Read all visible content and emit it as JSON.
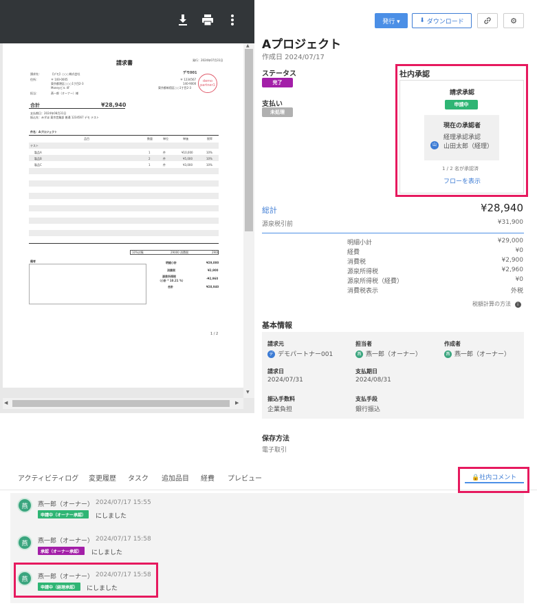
{
  "viewer": {
    "icons": [
      "download-icon",
      "print-icon",
      "more-vert-icon"
    ],
    "doc": {
      "title": "請求書",
      "date": "発行：2024年07月31日",
      "to_label": "請求先：",
      "to_name": "【デモ】○○○株式会社",
      "addr_label": "住所：",
      "addr1": "〒 100-0005",
      "addr2": "東京都港区○○○1丁目2-3",
      "addr3": "Moneyビル 4F",
      "person_label": "担当：",
      "person": "燕一郎（オーナー）様",
      "from_name": "デモ001",
      "from_zip": "〒 1234567",
      "from_tel": "140-9000",
      "from_addr": "東京都新宿区○○1丁目2-3",
      "stamp": "demo partner1",
      "total_label": "合計",
      "total": "¥28,940",
      "due": "支払期日：2024年08月31日",
      "bank": "振込先：みずほ 東京営業部 普通 1234567 デモ テスト",
      "subject": "件名：Aプロジェクト",
      "col_item": "品目",
      "col_qty": "数量",
      "col_unit": "単位",
      "col_price": "単価",
      "col_tax": "税率",
      "group": "テスト",
      "rows": [
        {
          "item": "製品A",
          "qty": "1",
          "unit": "件",
          "price": "¥10,000",
          "tax": "10%"
        },
        {
          "item": "製品B",
          "qty": "2",
          "unit": "件",
          "price": "¥5,000",
          "tax": "10%"
        },
        {
          "item": "製品C",
          "qty": "1",
          "unit": "件",
          "price": "¥3,000",
          "tax": "10%"
        }
      ],
      "tax_box1": "10%対象",
      "tax_box2": "29000",
      "tax_box3": "消費税",
      "tax_box4": "2900",
      "memo": "備考",
      "s1l": "明細小計",
      "s1v": "¥29,000",
      "s2l": "消費税",
      "s2v": "¥2,900",
      "s3l": "源泉所得税",
      "s3l2": "（小計 * 10.21 %）",
      "s3v": "-¥2,960",
      "s4l": "合計",
      "s4v": "¥28,940",
      "page": "1 / 2"
    }
  },
  "toolbar": {
    "issue": "発行 ▾",
    "download": "ダウンロード"
  },
  "header": {
    "title": "Aプロジェクト",
    "created": "作成日 2024/07/17"
  },
  "status": {
    "label": "ステータス",
    "value": "完了",
    "pay_label": "支払い",
    "pay_value": "未処理"
  },
  "approval": {
    "title": "社内承認",
    "sub": "請求承認",
    "badge": "申請中",
    "current_label": "現在の承認者",
    "step": "経理承認承認",
    "approver": "山田太郎（経理）",
    "approver_avatar": "山",
    "progress": "1 / 2 名が承認済",
    "flow_link": "フローを表示"
  },
  "totals": {
    "total_label": "総計",
    "total": "¥28,940",
    "pre_label": "源泉税引前",
    "pre": "¥31,900",
    "lines": [
      {
        "label": "明細小計",
        "value": "¥29,000"
      },
      {
        "label": "経費",
        "value": "¥0"
      },
      {
        "label": "消費税",
        "value": "¥2,900"
      },
      {
        "label": "源泉所得税",
        "value": "¥2,960"
      },
      {
        "label": "源泉所得税（経費）",
        "value": "¥0"
      },
      {
        "label": "消費税表示",
        "value": "外税"
      }
    ],
    "method": "税額計算の方法"
  },
  "basic": {
    "title": "基本情報",
    "from_label": "請求元",
    "from": "デモパートナー001",
    "from_av": "デ",
    "staff_label": "担当者",
    "staff": "燕一郎（オーナー）",
    "staff_av": "燕",
    "creator_label": "作成者",
    "creator": "燕一郎（オーナー）",
    "creator_av": "燕",
    "date_label": "請求日",
    "date": "2024/07/31",
    "due_label": "支払期日",
    "due": "2024/08/31",
    "fee_label": "振込手数料",
    "fee": "企業負担",
    "method_label": "支払手段",
    "method": "銀行振込"
  },
  "storage": {
    "label": "保存方法",
    "value": "電子取引"
  },
  "tabs": [
    "アクティビティログ",
    "変更履歴",
    "タスク",
    "追加品目",
    "経費",
    "プレビュー"
  ],
  "comment_tab": "社内コメント",
  "log": [
    {
      "avatar": "燕",
      "user": "燕一郎（オーナー）",
      "time": "2024/07/17 15:55",
      "tag": "申請中（オーナー承認）",
      "suffix": "にしました"
    },
    {
      "avatar": "燕",
      "user": "燕一郎（オーナー）",
      "time": "2024/07/17 15:58",
      "tag": "承認（オーナー承認）",
      "suffix": "にしました"
    },
    {
      "avatar": "燕",
      "user": "燕一郎（オーナー）",
      "time": "2024/07/17 15:58",
      "tag": "申請中（経理承認）",
      "suffix": "にしました"
    }
  ],
  "colors": {
    "accent": "#4b8fe6",
    "highlight": "#e6195e",
    "done": "#a31fa8",
    "pending": "#2fb574",
    "unpaid": "#b0b0b0"
  }
}
